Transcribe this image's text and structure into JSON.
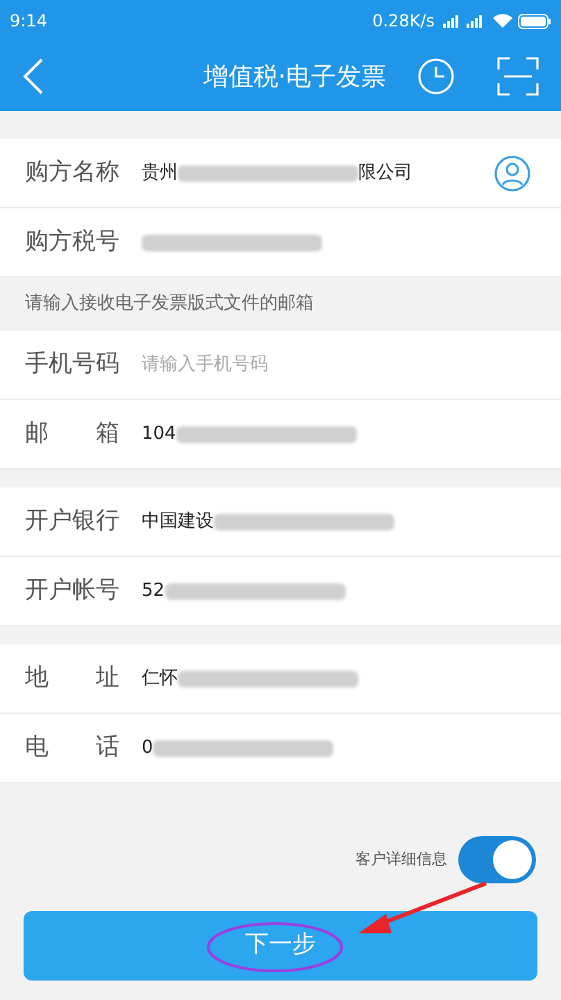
{
  "status_bar": {
    "time": "9:14",
    "speed": "0.28K/s"
  },
  "header": {
    "title": "增值税·电子发票"
  },
  "groups": [
    {
      "items": [
        {
          "label": "购方名称",
          "value": "贵州",
          "blurred": true,
          "value_end": "限公司",
          "kind": "contact"
        },
        {
          "label": "购方税号",
          "blurred": true
        }
      ]
    },
    {
      "notice": "请输入接收电子发票版式文件的邮箱",
      "items": [
        {
          "label": "手机号码",
          "placeholder": "请输入手机号码",
          "kind": "input"
        },
        {
          "label": "邮　　箱",
          "value": "104",
          "blurred": true
        }
      ]
    },
    {
      "items": [
        {
          "label": "开户银行",
          "value": "中国建设",
          "blurred": true
        },
        {
          "label": "开户帐号",
          "value": "52",
          "blurred": true
        }
      ]
    },
    {
      "items": [
        {
          "label": "地　　址",
          "value": "仁怀",
          "blurred": true
        },
        {
          "label": "电　　话",
          "value": "0",
          "blurred": true
        }
      ]
    }
  ],
  "detail_toggle": {
    "label": "客户详细信息",
    "on": true
  },
  "next_button": {
    "label": "下一步"
  },
  "annotation": {
    "circled": true,
    "arrow": true
  }
}
